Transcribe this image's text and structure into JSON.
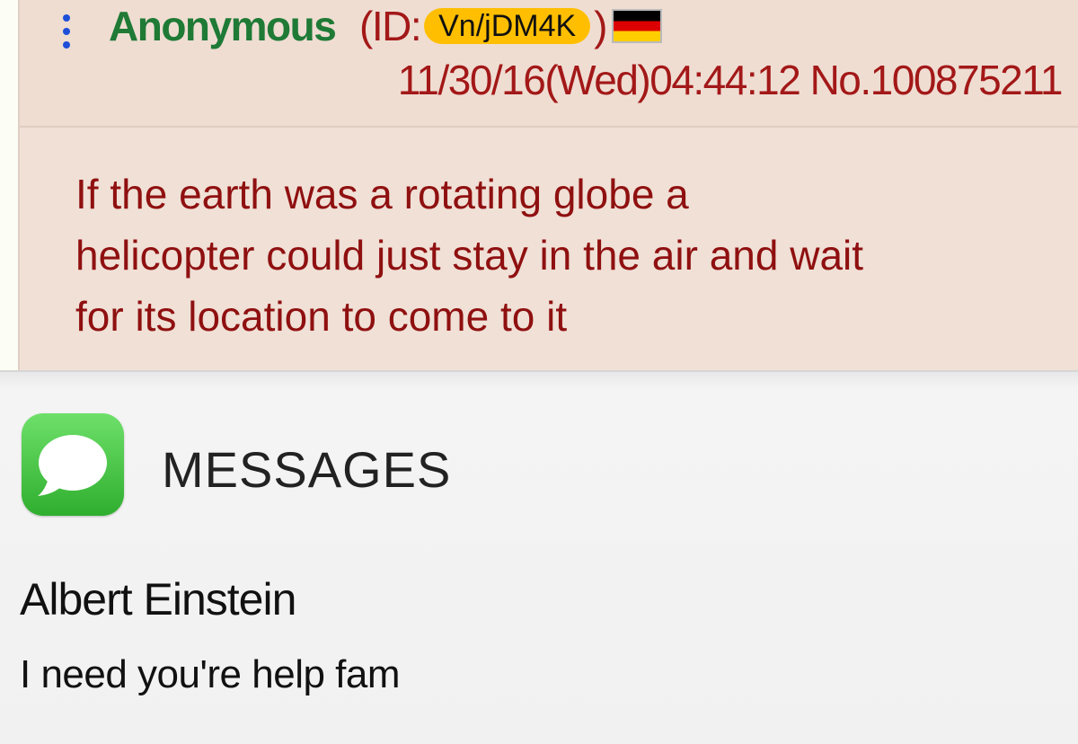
{
  "post": {
    "name": "Anonymous",
    "id_prefix": "(ID:",
    "id_value": "Vn/jDM4K",
    "id_suffix": ")",
    "flag_icon": "germany-flag-icon",
    "datetime": "11/30/16(Wed)04:44:12",
    "post_number": "No.100875211",
    "body_lines": [
      "If the earth was a rotating globe a",
      "helicopter could just stay in the air and wait",
      "for its location to come to it"
    ],
    "colors": {
      "name": "#1f7a35",
      "text": "#8f1010",
      "background": "#f0e0d6",
      "id_badge": "#ffbf00"
    }
  },
  "notification": {
    "app_icon": "messages-app-icon",
    "app_name": "MESSAGES",
    "sender": "Albert Einstein",
    "message": "I need you're help fam"
  }
}
